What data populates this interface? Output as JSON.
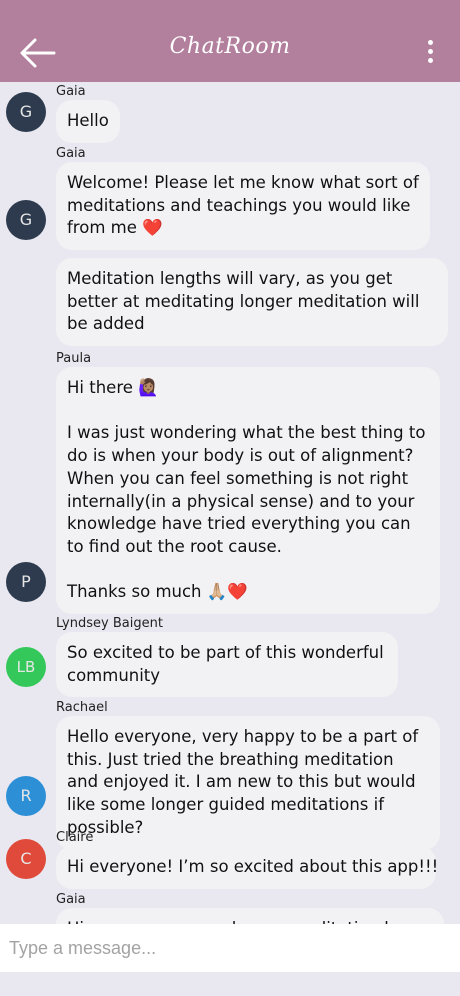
{
  "header": {
    "title": "ChatRoom",
    "back_icon": "arrow-left-icon",
    "menu_icon": "more-vertical-icon",
    "background": "#b27f9d"
  },
  "messages": [
    {
      "sender": "Gaia",
      "avatar_initials": "G",
      "avatar_color": "#2e3b4e",
      "bubbles": [
        "Hello"
      ]
    },
    {
      "sender": "Gaia",
      "avatar_initials": "G",
      "avatar_color": "#2e3b4e",
      "bubbles": [
        "Welcome! Please let me know what sort of meditations and teachings you would like from me ❤️",
        "Meditation lengths will vary, as you get better at meditating longer meditation will be added"
      ]
    },
    {
      "sender": "Paula",
      "avatar_initials": "P",
      "avatar_color": "#2e3b4e",
      "bubbles": [
        "Hi there 🙋🏽‍♀️\n\nI was just wondering what the best thing to do is when your body is out of alignment? When you can feel something is not right internally(in a physical sense) and to your knowledge have tried everything you can to find out the root cause.\n\nThanks so much 🙏🏼❤️"
      ]
    },
    {
      "sender": "Lyndsey Baigent",
      "avatar_initials": "LB",
      "avatar_color": "#34c759",
      "bubbles": [
        "So excited to be part of this wonderful community"
      ]
    },
    {
      "sender": "Rachael",
      "avatar_initials": "R",
      "avatar_color": "#2d8fd5",
      "bubbles": [
        "Hello everyone, very happy to be a part of this. Just tried the breathing meditation and enjoyed it. I am new to this but would like some longer guided meditations if possible?"
      ]
    },
    {
      "sender": "Claire",
      "avatar_initials": "C",
      "avatar_color": "#e04a3a",
      "bubbles": [
        "Hi everyone! I’m so excited about this app!!!"
      ]
    },
    {
      "sender": "Gaia",
      "avatar_initials": "",
      "avatar_color": "#2e3b4e",
      "bubbles": [
        "Hi everyone, a new longer meditation has"
      ]
    }
  ],
  "composer": {
    "placeholder": "Type a message..."
  }
}
